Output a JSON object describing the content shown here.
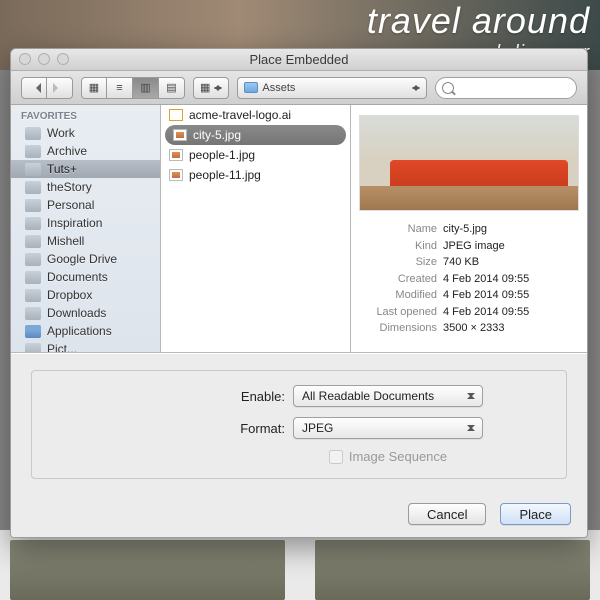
{
  "bg": {
    "headline": "travel around",
    "sub": "and discover"
  },
  "window": {
    "title": "Place Embedded"
  },
  "toolbar": {
    "path_folder": "Assets"
  },
  "sidebar": {
    "header": "FAVORITES",
    "items": [
      {
        "label": "Work"
      },
      {
        "label": "Archive"
      },
      {
        "label": "Tuts+",
        "selected": true
      },
      {
        "label": "theStory"
      },
      {
        "label": "Personal"
      },
      {
        "label": "Inspiration"
      },
      {
        "label": "Mishell"
      },
      {
        "label": "Google Drive"
      },
      {
        "label": "Documents"
      },
      {
        "label": "Dropbox"
      },
      {
        "label": "Downloads"
      },
      {
        "label": "Applications",
        "app": true
      },
      {
        "label": "Pict..."
      }
    ]
  },
  "files": [
    {
      "name": "acme-travel-logo.ai",
      "type": "ai"
    },
    {
      "name": "city-5.jpg",
      "type": "img",
      "selected": true
    },
    {
      "name": "people-1.jpg",
      "type": "img"
    },
    {
      "name": "people-11.jpg",
      "type": "img"
    }
  ],
  "meta": {
    "rows": [
      {
        "k": "Name",
        "v": "city-5.jpg"
      },
      {
        "k": "Kind",
        "v": "JPEG image"
      },
      {
        "k": "Size",
        "v": "740 KB"
      },
      {
        "k": "Created",
        "v": "4 Feb 2014 09:55"
      },
      {
        "k": "Modified",
        "v": "4 Feb 2014 09:55"
      },
      {
        "k": "Last opened",
        "v": "4 Feb 2014 09:55"
      },
      {
        "k": "Dimensions",
        "v": "3500 × 2333"
      }
    ]
  },
  "options": {
    "enable_label": "Enable:",
    "enable_value": "All Readable Documents",
    "format_label": "Format:",
    "format_value": "JPEG",
    "seq_label": "Image Sequence"
  },
  "footer": {
    "cancel": "Cancel",
    "place": "Place"
  }
}
